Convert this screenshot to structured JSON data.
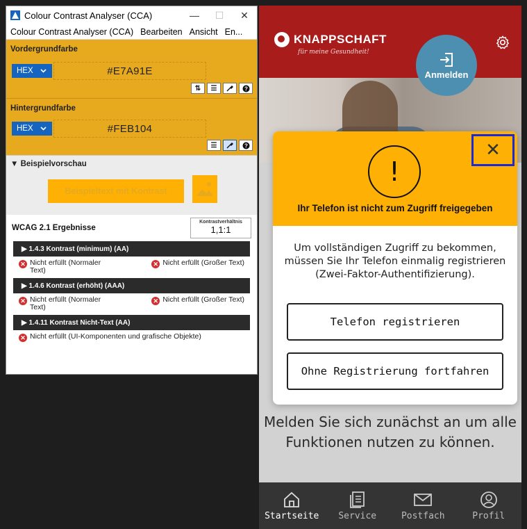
{
  "cca": {
    "window_title": "Colour Contrast Analyser (CCA)",
    "window_controls": {
      "minimize": "—",
      "maximize": "☐",
      "close": "✕"
    },
    "menu": [
      "Colour Contrast Analyser (CCA)",
      "Bearbeiten",
      "Ansicht",
      "En..."
    ],
    "foreground": {
      "heading": "Vordergrundfarbe",
      "format": "HEX",
      "value": "#E7A91E",
      "color": "#e7a91e"
    },
    "background": {
      "heading": "Hintergrundfarbe",
      "format": "HEX",
      "value": "#FEB104",
      "color": "#feb104"
    },
    "preview": {
      "heading": "▼ Beispielvorschau",
      "sample_text": "Beispieltext mit Kontrast"
    },
    "results": {
      "title": "WCAG 2.1 Ergebnisse",
      "ratio_label": "Kontrastverhältnis",
      "ratio_value": "1,1:1",
      "criteria": [
        {
          "label": "▶ 1.4.3 Kontrast (minimum) (AA)",
          "normal": "Nicht erfüllt (Normaler Text)",
          "large": "Nicht erfüllt (Großer Text)"
        },
        {
          "label": "▶ 1.4.6 Kontrast (erhöht) (AAA)",
          "normal": "Nicht erfüllt (Normaler Text)",
          "large": "Nicht erfüllt (Großer Text)"
        },
        {
          "label": "▶ 1.4.11 Kontrast Nicht-Text (AA)",
          "ui": "Nicht erfüllt (UI-Komponenten und grafische Objekte)"
        }
      ]
    }
  },
  "app": {
    "logo_text": "KNAPPSCHAFT",
    "logo_subtitle": "für meine Gesundheit!",
    "login_label": "Anmelden",
    "dialog": {
      "title": "Ihr Telefon ist nicht zum Zugriff freigegeben",
      "message": "Um vollständigen Zugriff zu bekommen, müssen Sie Ihr Telefon einmalig registrieren (Zwei-Faktor-Authentifizierung).",
      "primary_button": "Telefon registrieren",
      "secondary_button": "Ohne Registrierung fortfahren",
      "close_symbol": "✕",
      "warning_symbol": "!"
    },
    "background_text": "Melden Sie sich zunächst an um alle Funktionen nutzen zu können.",
    "nav": [
      {
        "label": "Startseite",
        "icon": "home-icon",
        "active": true
      },
      {
        "label": "Service",
        "icon": "document-icon",
        "active": false
      },
      {
        "label": "Postfach",
        "icon": "mail-icon",
        "active": false
      },
      {
        "label": "Profil",
        "icon": "profile-icon",
        "active": false
      }
    ],
    "colors": {
      "header": "#a81c1c",
      "dialog_header": "#feb104",
      "login_circle": "#4d8fb0",
      "focus_outline": "#1a2bd6",
      "nav_bg": "#343434"
    }
  }
}
